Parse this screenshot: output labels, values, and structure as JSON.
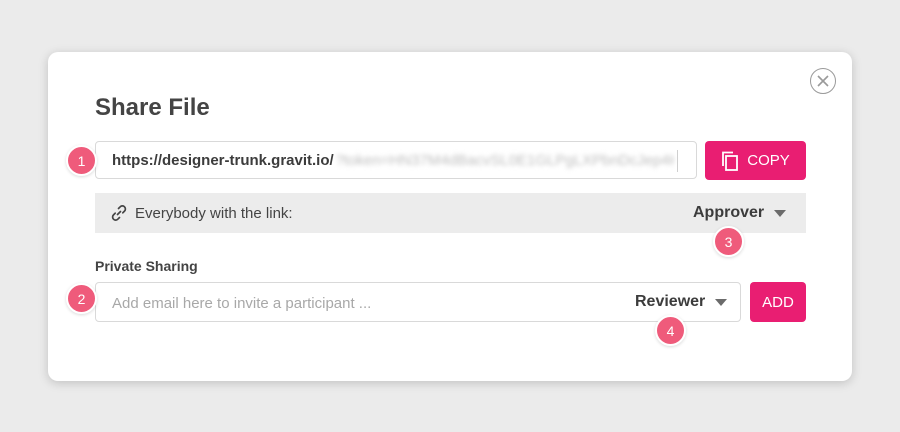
{
  "dialog": {
    "title": "Share File",
    "close_icon": "close-circle-icon"
  },
  "link": {
    "url_visible": "https://designer-trunk.gravit.io/",
    "url_blurred": "?token=HN37M4dBacvSL0E1GLPgLXPbnDcJep4Kb",
    "copy_label": "COPY",
    "copy_icon": "copy-icon"
  },
  "public_access": {
    "icon": "link-icon",
    "label": "Everybody with the link:",
    "permission": "Approver"
  },
  "private_sharing": {
    "section_label": "Private Sharing",
    "email_placeholder": "Add email here to invite a participant ...",
    "email_value": "",
    "permission": "Reviewer",
    "add_label": "ADD"
  },
  "annotations": {
    "badges": [
      "1",
      "2",
      "3",
      "4"
    ]
  },
  "colors": {
    "accent": "#e91e72",
    "badge": "#ef5b7b",
    "row_bg": "#ececec",
    "page_bg": "#ebebeb"
  }
}
